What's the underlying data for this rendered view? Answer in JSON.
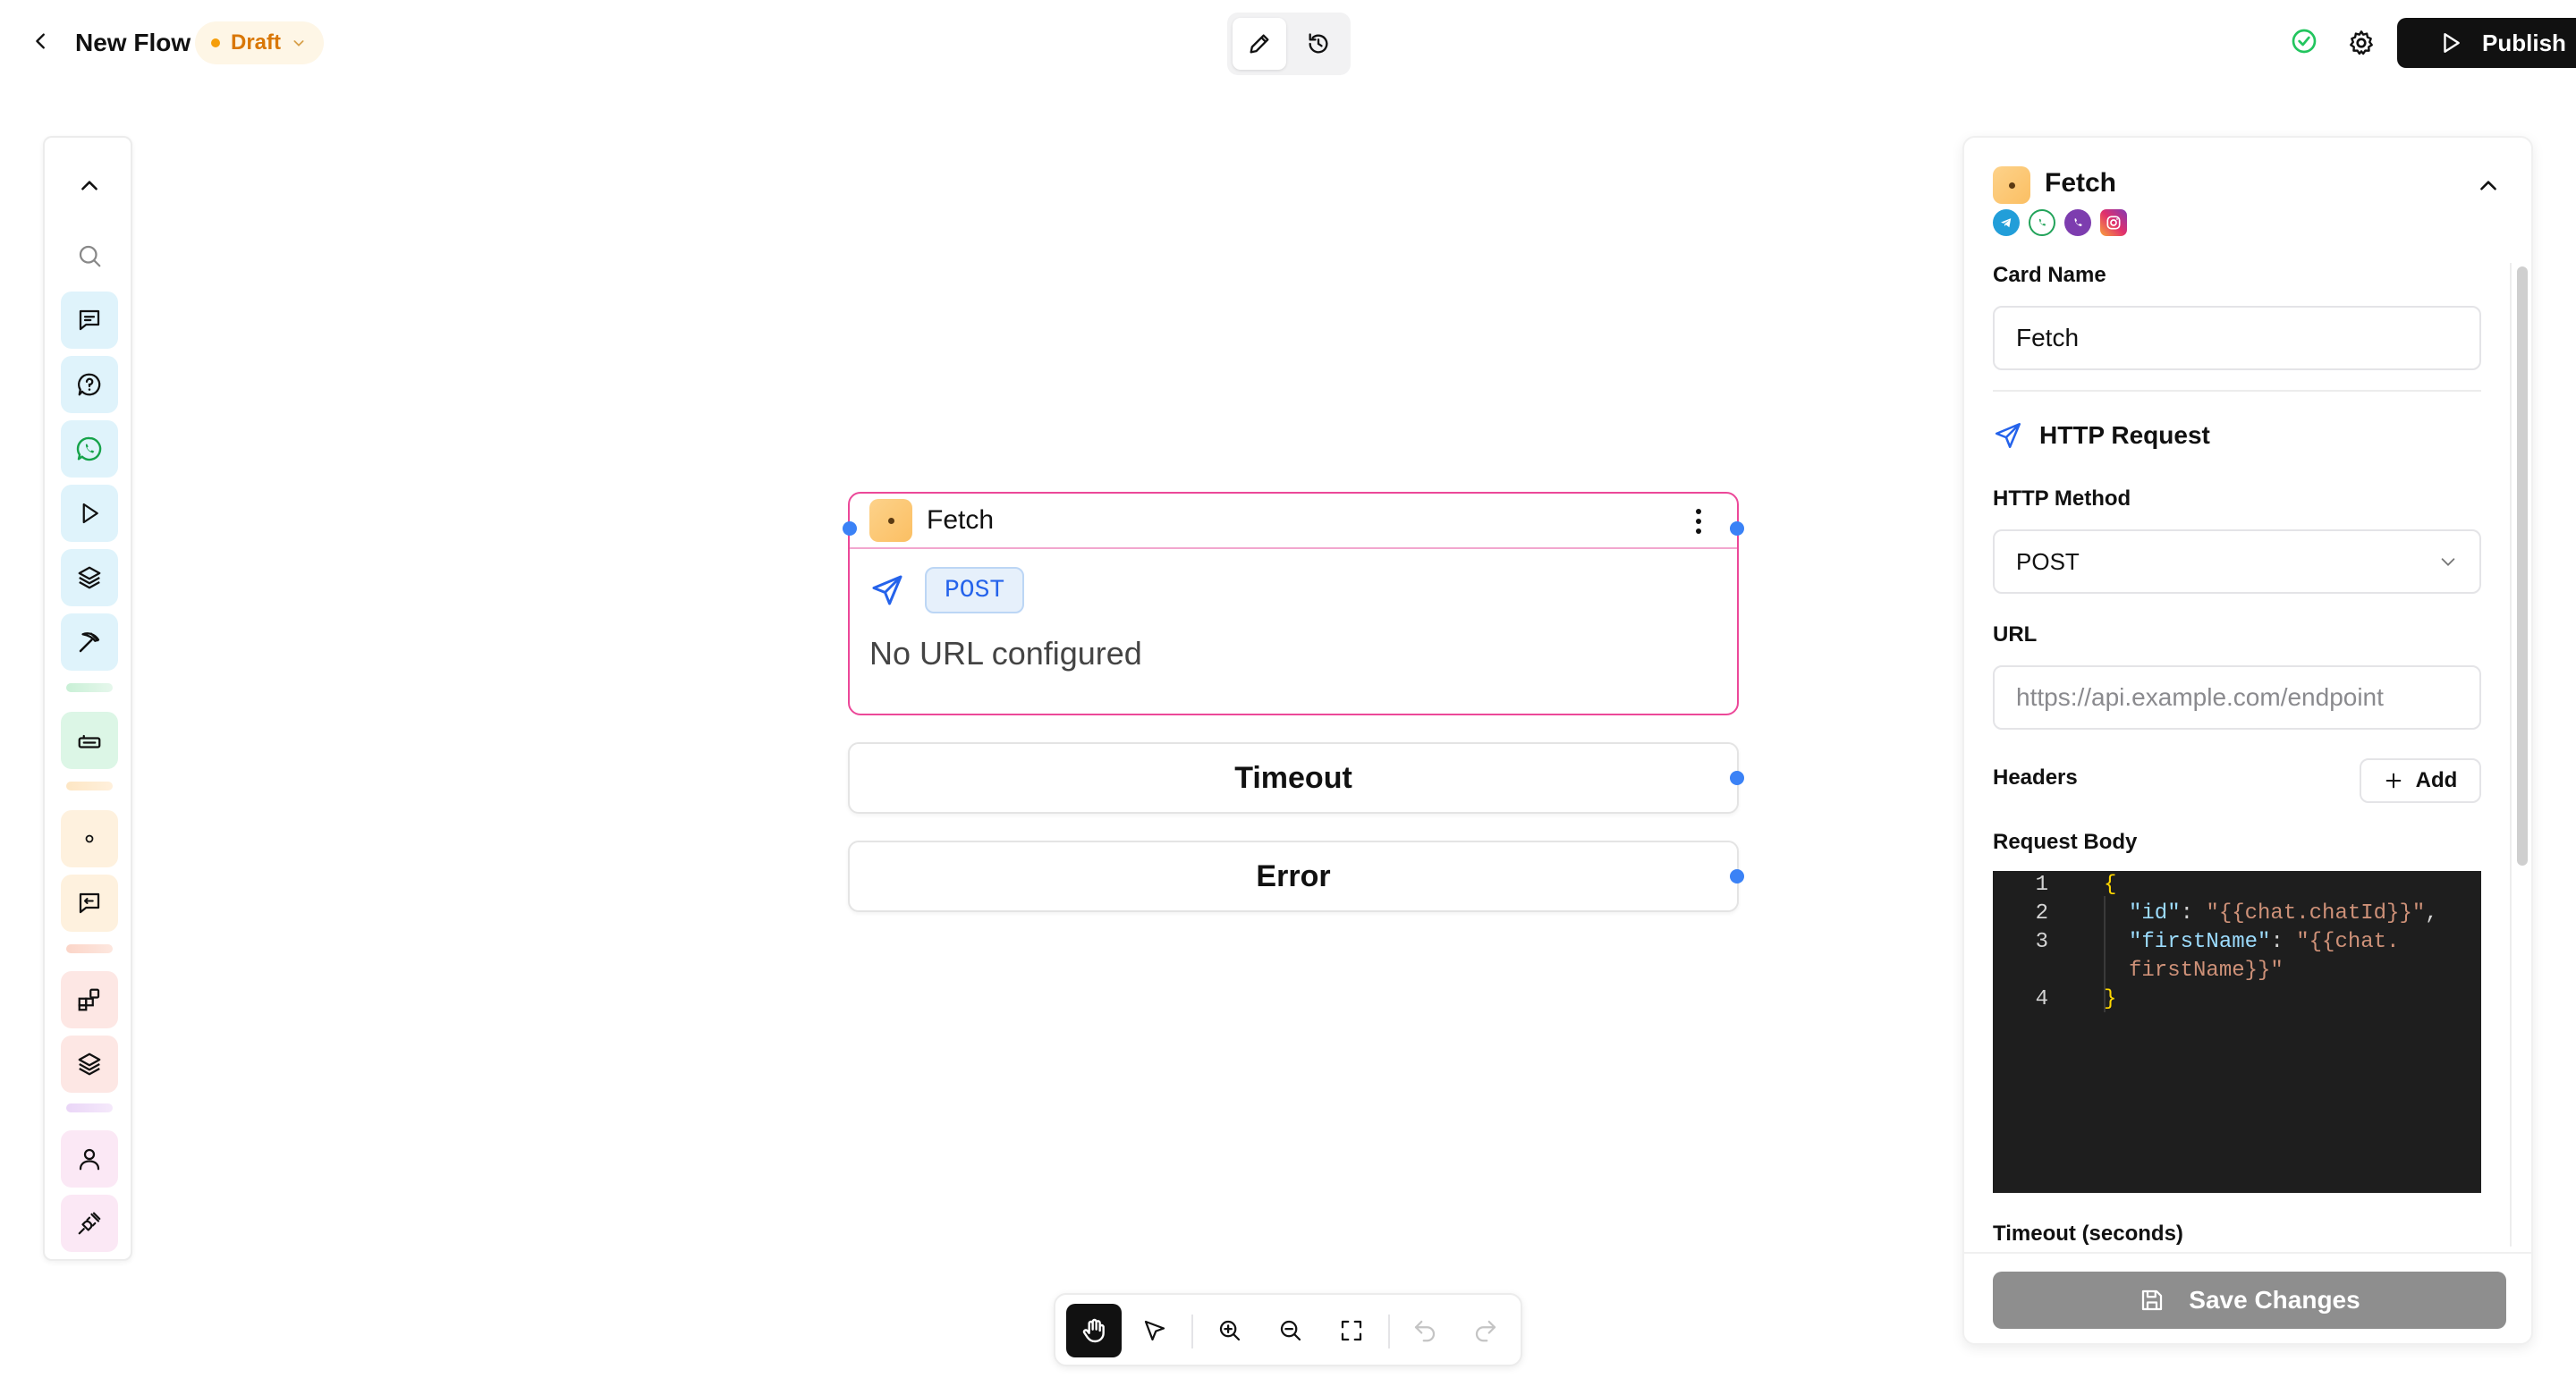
{
  "header": {
    "flow_title": "New Flow",
    "status_badge": "Draft",
    "publish_label": "Publish",
    "colors": {
      "draft": "#f59e0b",
      "saved_ok": "#22c55e"
    }
  },
  "left_toolbar": {
    "icons": [
      "chevron-up-icon",
      "search-icon",
      "message-square-icon",
      "message-question-icon",
      "whatsapp-icon",
      "play-icon",
      "layers-icon",
      "pickaxe-icon",
      "keyboard-icon",
      "dot-icon",
      "message-reply-icon",
      "blocks-icon",
      "layers-stack-icon",
      "user-icon",
      "plug-icon"
    ]
  },
  "canvas": {
    "node": {
      "title": "Fetch",
      "method": "POST",
      "url_text": "No URL configured"
    },
    "branches": [
      "Timeout",
      "Error"
    ]
  },
  "panel": {
    "title": "Fetch",
    "channels": [
      "telegram",
      "whatsapp",
      "viber",
      "instagram"
    ],
    "card_name_label": "Card Name",
    "card_name_value": "Fetch",
    "section_title": "HTTP Request",
    "method_label": "HTTP Method",
    "method_value": "POST",
    "url_label": "URL",
    "url_placeholder": "https://api.example.com/endpoint",
    "headers_label": "Headers",
    "add_label": "Add",
    "body_label": "Request Body",
    "body_lines": [
      {
        "num": "1",
        "text": "{"
      },
      {
        "num": "2",
        "key": "\"id\"",
        "sep": ": ",
        "val": "\"{{chat.chatId}}\"",
        "tail": ","
      },
      {
        "num": "3",
        "key": "\"firstName\"",
        "sep": ": ",
        "val": "\"{{chat.",
        "tail": ""
      },
      {
        "num": "",
        "val": "firstName}}\""
      },
      {
        "num": "4",
        "text": "}"
      }
    ],
    "timeout_label": "Timeout (seconds)",
    "save_label": "Save Changes"
  }
}
